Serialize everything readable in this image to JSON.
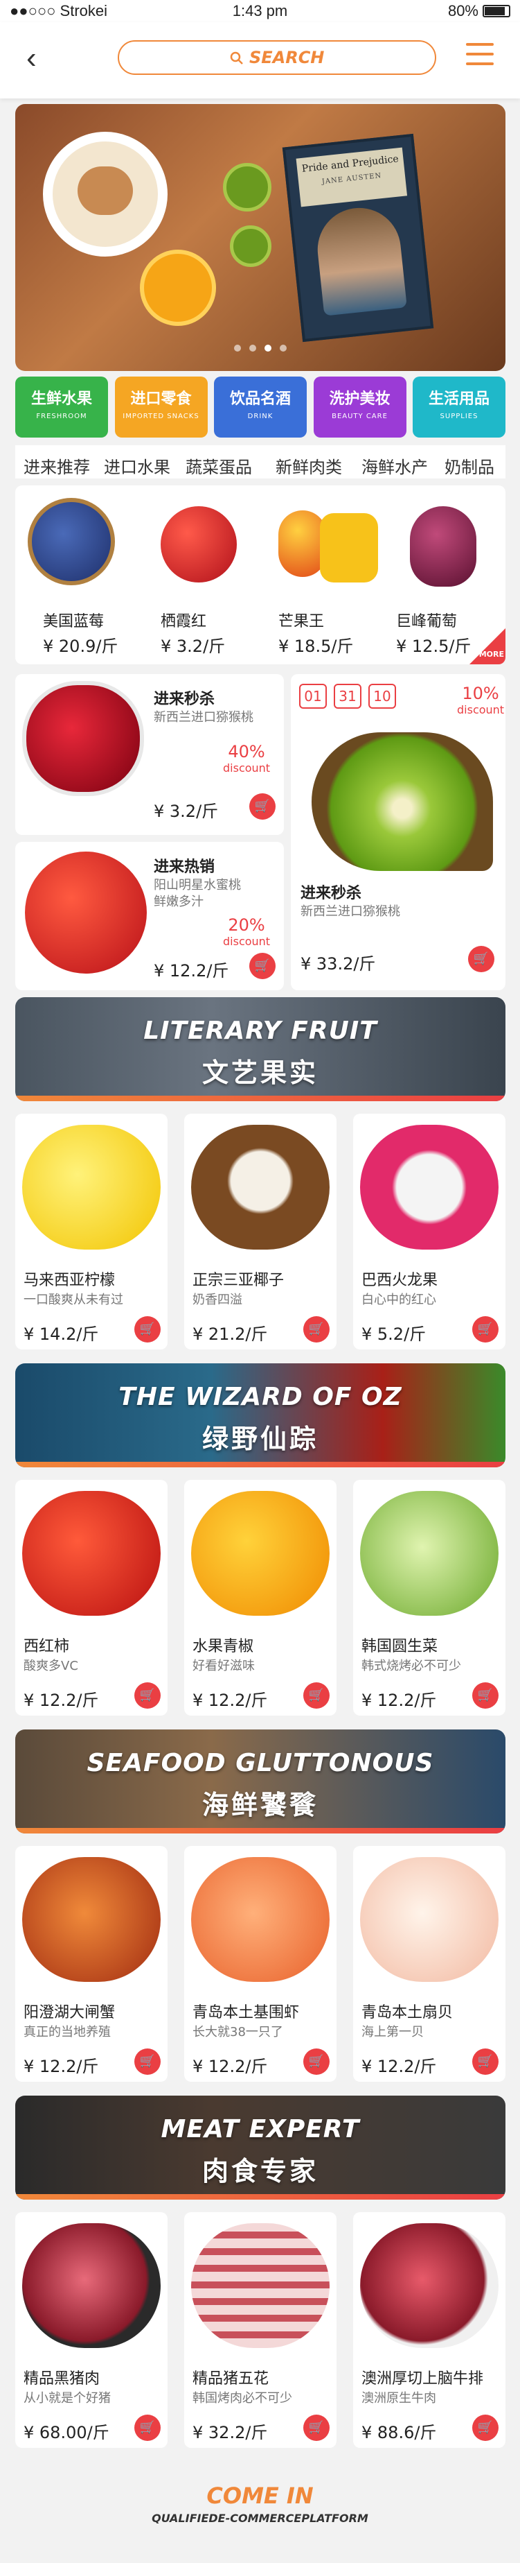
{
  "status": {
    "carrier": "●●○○○ Strokei",
    "time": "1:43 pm",
    "battery": "80%"
  },
  "nav": {
    "back": "‹",
    "search": "SEARCH"
  },
  "banner": {
    "book_title": "Pride and Prejudice",
    "book_author": "JANE AUSTEN"
  },
  "categories": [
    {
      "cn": "生鲜水果",
      "en": "FRESHROOM",
      "color": "#37b34a"
    },
    {
      "cn": "进口零食",
      "en": "IMPORTED SNACKS",
      "color": "#f5a623"
    },
    {
      "cn": "饮品名酒",
      "en": "DRINK",
      "color": "#3a6fd8"
    },
    {
      "cn": "洗护美妆",
      "en": "BEAUTY CARE",
      "color": "#9b3bd6"
    },
    {
      "cn": "生活用品",
      "en": "SUPPLIES",
      "color": "#1fb8c9"
    }
  ],
  "tabs": [
    "进来推荐",
    "进口水果",
    "蔬菜蛋品",
    "新鲜肉类",
    "海鲜水产",
    "奶制品"
  ],
  "recommend": [
    {
      "name": "美国蓝莓",
      "price": "¥ 20.9/斤"
    },
    {
      "name": "栖霞红",
      "price": "¥ 3.2/斤"
    },
    {
      "name": "芒果王",
      "price": "¥ 18.5/斤"
    },
    {
      "name": "巨峰葡萄",
      "price": "¥ 12.5/斤"
    }
  ],
  "more": "MORE",
  "flash": {
    "cherry": {
      "title": "进来秒杀",
      "desc": "新西兰进口猕猴桃",
      "discount": "40%",
      "discount_label": "discount",
      "price": "¥ 3.2/斤"
    },
    "apple": {
      "title": "进来热销",
      "desc1": "阳山明星水蜜桃",
      "desc2": "鲜嫩多汁",
      "discount": "20%",
      "discount_label": "discount",
      "price": "¥ 12.2/斤"
    },
    "kiwi": {
      "title": "进来秒杀",
      "desc": "新西兰进口猕猴桃",
      "timer": [
        "01",
        "31",
        "10"
      ],
      "discount": "10%",
      "discount_label": "discount",
      "price": "¥ 33.2/斤"
    }
  },
  "sections": [
    {
      "en": "LITERARY FRUIT",
      "cn": "文艺果实",
      "items": [
        {
          "name": "马来西亚柠檬",
          "desc": "一口酸爽从未有过",
          "price": "¥ 14.2/斤"
        },
        {
          "name": "正宗三亚椰子",
          "desc": "奶香四溢",
          "price": "¥ 21.2/斤"
        },
        {
          "name": "巴西火龙果",
          "desc": "白心中的红心",
          "price": "¥ 5.2/斤"
        }
      ]
    },
    {
      "en": "THE WIZARD OF OZ",
      "cn": "绿野仙踪",
      "items": [
        {
          "name": "西红柿",
          "desc": "酸爽多VC",
          "price": "¥ 12.2/斤"
        },
        {
          "name": "水果青椒",
          "desc": "好看好滋味",
          "price": "¥ 12.2/斤"
        },
        {
          "name": "韩国圆生菜",
          "desc": "韩式烧烤必不可少",
          "price": "¥ 12.2/斤"
        }
      ]
    },
    {
      "en": "SEAFOOD GLUTTONOUS",
      "cn": "海鲜饕餮",
      "items": [
        {
          "name": "阳澄湖大闸蟹",
          "desc": "真正的当地养殖",
          "price": "¥ 12.2/斤"
        },
        {
          "name": "青岛本土基围虾",
          "desc": "长大就38一只了",
          "price": "¥ 12.2/斤"
        },
        {
          "name": "青岛本土扇贝",
          "desc": "海上第一贝",
          "price": "¥ 12.2/斤"
        }
      ]
    },
    {
      "en": "MEAT EXPERT",
      "cn": "肉食专家",
      "items": [
        {
          "name": "精品黑猪肉",
          "desc": "从小就是个好猪",
          "price": "¥ 68.00/斤"
        },
        {
          "name": "精品猪五花",
          "desc": "韩国烤肉必不可少",
          "price": "¥ 32.2/斤"
        },
        {
          "name": "澳洲厚切上脑牛排",
          "desc": "澳洲原生牛肉",
          "price": "¥ 88.6/斤"
        }
      ]
    }
  ],
  "footer": {
    "line1": "COME IN",
    "line2": "QUALIFIEDE-COMMERCEPLATFORM"
  }
}
